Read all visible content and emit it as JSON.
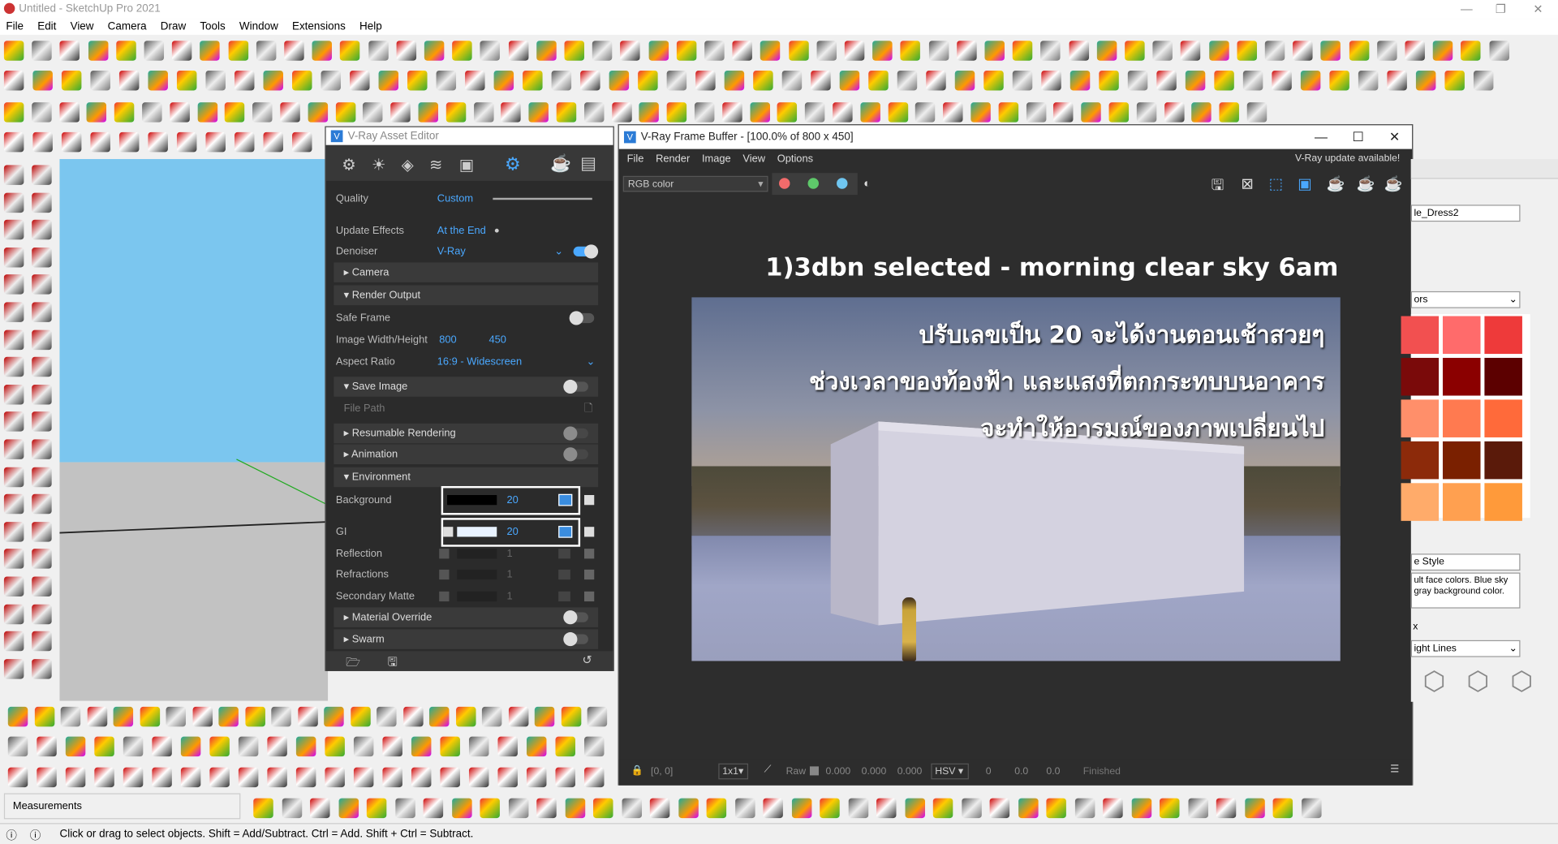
{
  "window": {
    "title": "Untitled - SketchUp Pro 2021"
  },
  "menubar": [
    "File",
    "Edit",
    "View",
    "Camera",
    "Draw",
    "Tools",
    "Window",
    "Extensions",
    "Help"
  ],
  "asset_editor": {
    "title": "V-Ray Asset Editor",
    "quality_label": "Quality",
    "quality_value": "Custom",
    "update_effects_label": "Update Effects",
    "update_effects_value": "At the End",
    "denoiser_label": "Denoiser",
    "denoiser_value": "V-Ray",
    "camera_section": "Camera",
    "render_output_section": "Render Output",
    "safe_frame_label": "Safe Frame",
    "image_wh_label": "Image Width/Height",
    "image_width": "800",
    "image_height": "450",
    "aspect_label": "Aspect Ratio",
    "aspect_value": "16:9 - Widescreen",
    "save_image_label": "Save Image",
    "file_path_label": "File Path",
    "resumable_label": "Resumable Rendering",
    "animation_label": "Animation",
    "environment_section": "Environment",
    "background_label": "Background",
    "background_value": "20",
    "gi_label": "GI",
    "gi_value": "20",
    "reflection_label": "Reflection",
    "reflection_value": "1",
    "refractions_label": "Refractions",
    "refractions_value": "1",
    "secondary_matte_label": "Secondary Matte",
    "secondary_matte_value": "1",
    "material_override_label": "Material Override",
    "swarm_label": "Swarm"
  },
  "frame_buffer": {
    "title": "V-Ray Frame Buffer - [100.0% of 800 x 450]",
    "menu": [
      "File",
      "Render",
      "Image",
      "View",
      "Options"
    ],
    "update_notice": "V-Ray update available!",
    "channel": "RGB color",
    "heading": "1)3dbn selected - morning clear sky 6am",
    "overlay_line1": "ปรับเลขเป็น 20 จะได้งานตอนเช้าสวยๆ",
    "overlay_line2": "ช่วงเวลาของท้องฟ้า และแสงที่ตกกระทบบนอาคาร",
    "overlay_line3": "จะทำให้อารมณ์ของภาพเปลี่ยนไป",
    "status": {
      "coords": "[0, 0]",
      "zoom": "1x1",
      "raw_label": "Raw",
      "r": "0.000",
      "g": "0.000",
      "b": "0.000",
      "mode": "HSV",
      "h": "0",
      "s": "0.0",
      "v": "0.0",
      "state": "Finished"
    }
  },
  "right_panel": {
    "material_name": "le_Dress2",
    "colors_label": "ors",
    "style_name": "e Style",
    "style_desc": "ult face colors. Blue sky gray background color.",
    "x_label": "x",
    "edge_label": "ight Lines"
  },
  "measurements_label": "Measurements",
  "status_hint": "Click or drag to select objects. Shift = Add/Subtract. Ctrl = Add. Shift + Ctrl = Subtract."
}
